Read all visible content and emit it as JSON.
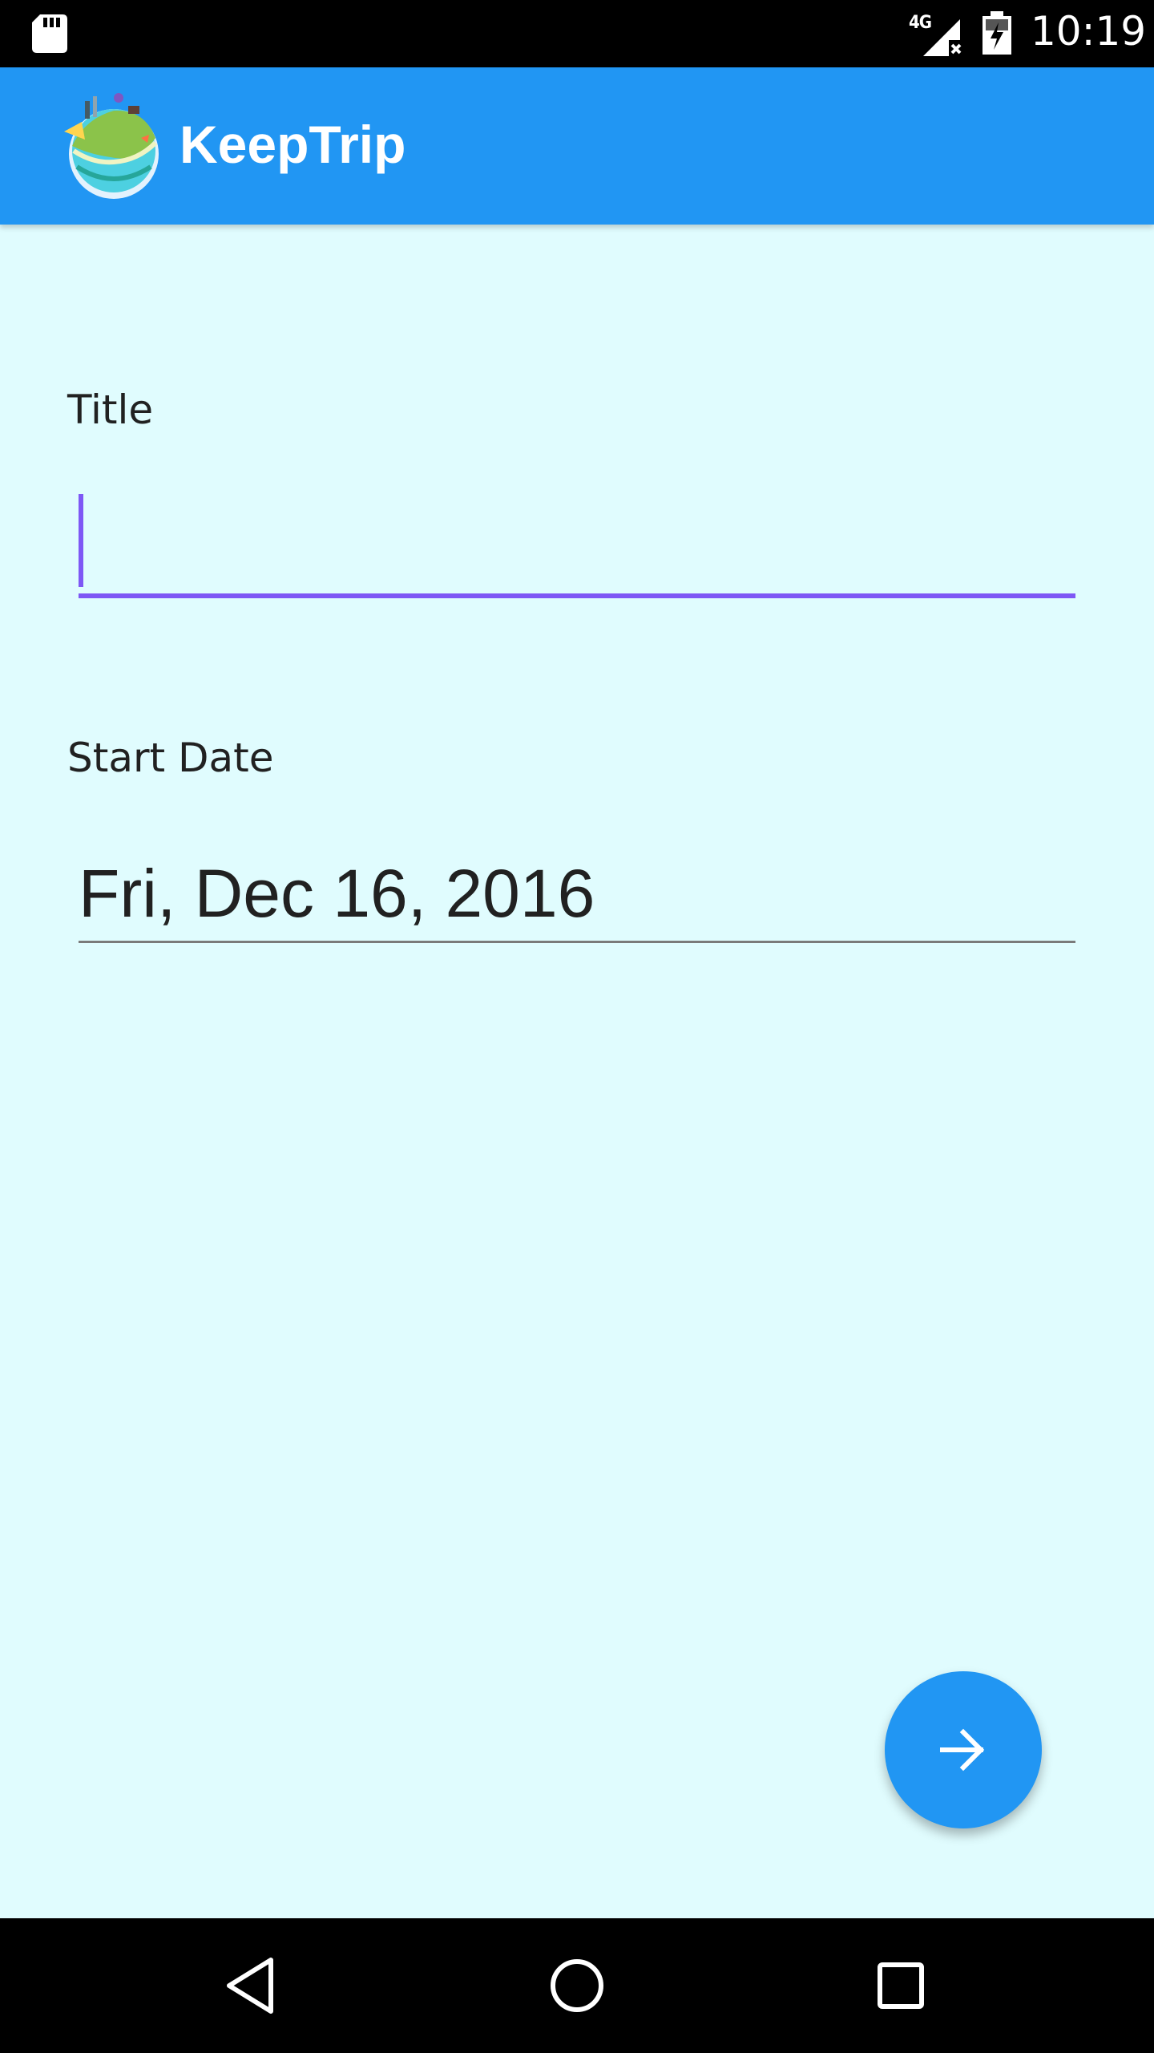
{
  "status_bar": {
    "time": "10:19",
    "network_type": "4G",
    "icons": [
      "sd-card-icon",
      "signal-no-data-icon",
      "battery-charging-icon"
    ]
  },
  "app_bar": {
    "title": "KeepTrip",
    "logo_icon": "globe-island-logo-icon",
    "background_color": "#2196F3"
  },
  "form": {
    "title_field": {
      "label": "Title",
      "value": "",
      "accent_color": "#7E57F5"
    },
    "start_date_field": {
      "label": "Start Date",
      "value": "Fri, Dec 16, 2016"
    }
  },
  "fab": {
    "icon": "arrow-forward-icon",
    "color": "#2196F3"
  },
  "nav_bar": {
    "buttons": [
      "back-icon",
      "home-icon",
      "recents-icon"
    ]
  },
  "colors": {
    "page_background": "#E0FCFE",
    "text_primary": "#212121"
  }
}
